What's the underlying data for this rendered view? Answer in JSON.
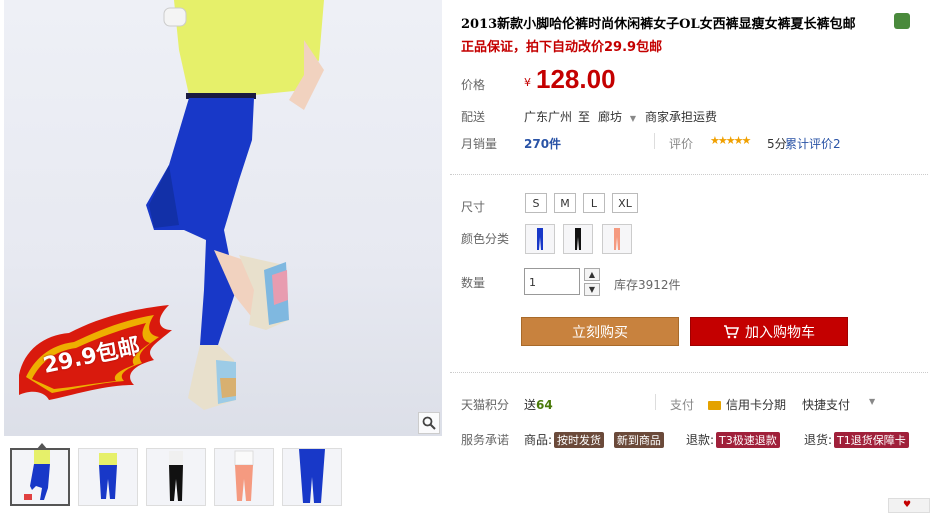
{
  "product": {
    "title": "2013新款小脚哈伦裤时尚休闲裤女子OL女西裤显瘦女裤夏长裤包邮",
    "subtitle": "正品保证，拍下自动改价29.9包邮",
    "promo_badge": "29.9包邮"
  },
  "price": {
    "label": "价格",
    "currency": "¥",
    "value": "128.00"
  },
  "delivery": {
    "label": "配送",
    "from": "广东广州",
    "to_word": "至",
    "to": "廊坊",
    "fee": "商家承担运费"
  },
  "sales": {
    "label": "月销量",
    "count": "270件",
    "rating_label": "评价",
    "stars": "★★★★★",
    "score": "5分",
    "reviews": "累计评价2"
  },
  "size": {
    "label": "尺寸",
    "options": [
      "S",
      "M",
      "L",
      "XL"
    ]
  },
  "color": {
    "label": "颜色分类",
    "swatches": [
      "blue",
      "black",
      "peach"
    ]
  },
  "quantity": {
    "label": "数量",
    "value": "1",
    "stock": "库存3912件"
  },
  "buttons": {
    "buy": "立刻购买",
    "cart": "加入购物车"
  },
  "points": {
    "label": "天猫积分",
    "give": "送",
    "value": "64",
    "pay_label": "支付",
    "card": "信用卡分期",
    "quick": "快捷支付"
  },
  "service": {
    "label": "服务承诺",
    "goods_label": "商品:",
    "goods_badges": [
      "按时发货",
      "新到商品"
    ],
    "refund_label": "退款:",
    "refund_badge": "T3极速退款",
    "return_label": "退货:",
    "return_badge": "T1退货保障卡"
  },
  "thumbnails": [
    "blue-yellow",
    "blue",
    "black",
    "peach",
    "blue-legs"
  ],
  "colors": {
    "price_red": "#c40000",
    "buy_orange": "#c8823e",
    "cart_red": "#c40000",
    "link_blue": "#2953a6"
  }
}
